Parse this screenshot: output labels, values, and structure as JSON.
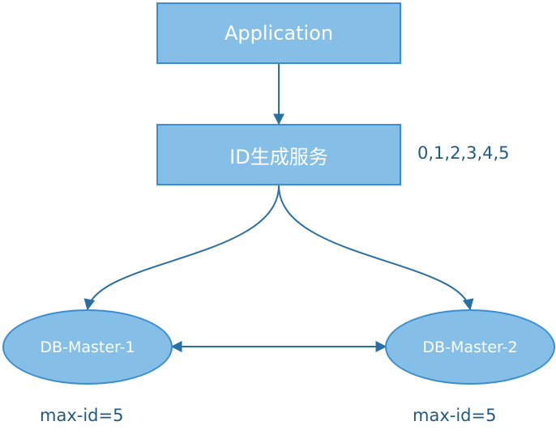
{
  "nodes": {
    "application": "Application",
    "id_service": "ID生成服务",
    "db_master_1": "DB-Master-1",
    "db_master_2": "DB-Master-2"
  },
  "labels": {
    "id_sequence": "0,1,2,3,4,5",
    "max_id_1": "max-id=5",
    "max_id_2": "max-id=5"
  },
  "colors": {
    "node_fill": "#85bfe8",
    "node_border": "#3a8ed0",
    "edge": "#2a6fa3",
    "label_text": "#1f5a86"
  }
}
